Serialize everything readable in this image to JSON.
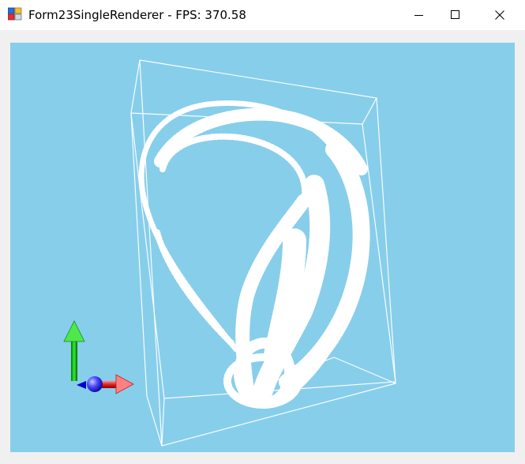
{
  "window": {
    "title": "Form23SingleRenderer - FPS: 370.58"
  },
  "titlebar": {
    "app_icon": "windows-form-icon",
    "minimize_icon": "minimize-icon",
    "maximize_icon": "maximize-icon",
    "close_icon": "close-icon"
  },
  "viewport": {
    "background_color": "#87ceeb",
    "model": "klein-bottle-point-cloud",
    "bounding_box": "wireframe-box",
    "axis_gizmo": {
      "y_axis_color": "#00cc00",
      "x_axis_color": "#e02020",
      "z_axis_color": "#0000cc",
      "origin_color": "#4040ff"
    }
  }
}
